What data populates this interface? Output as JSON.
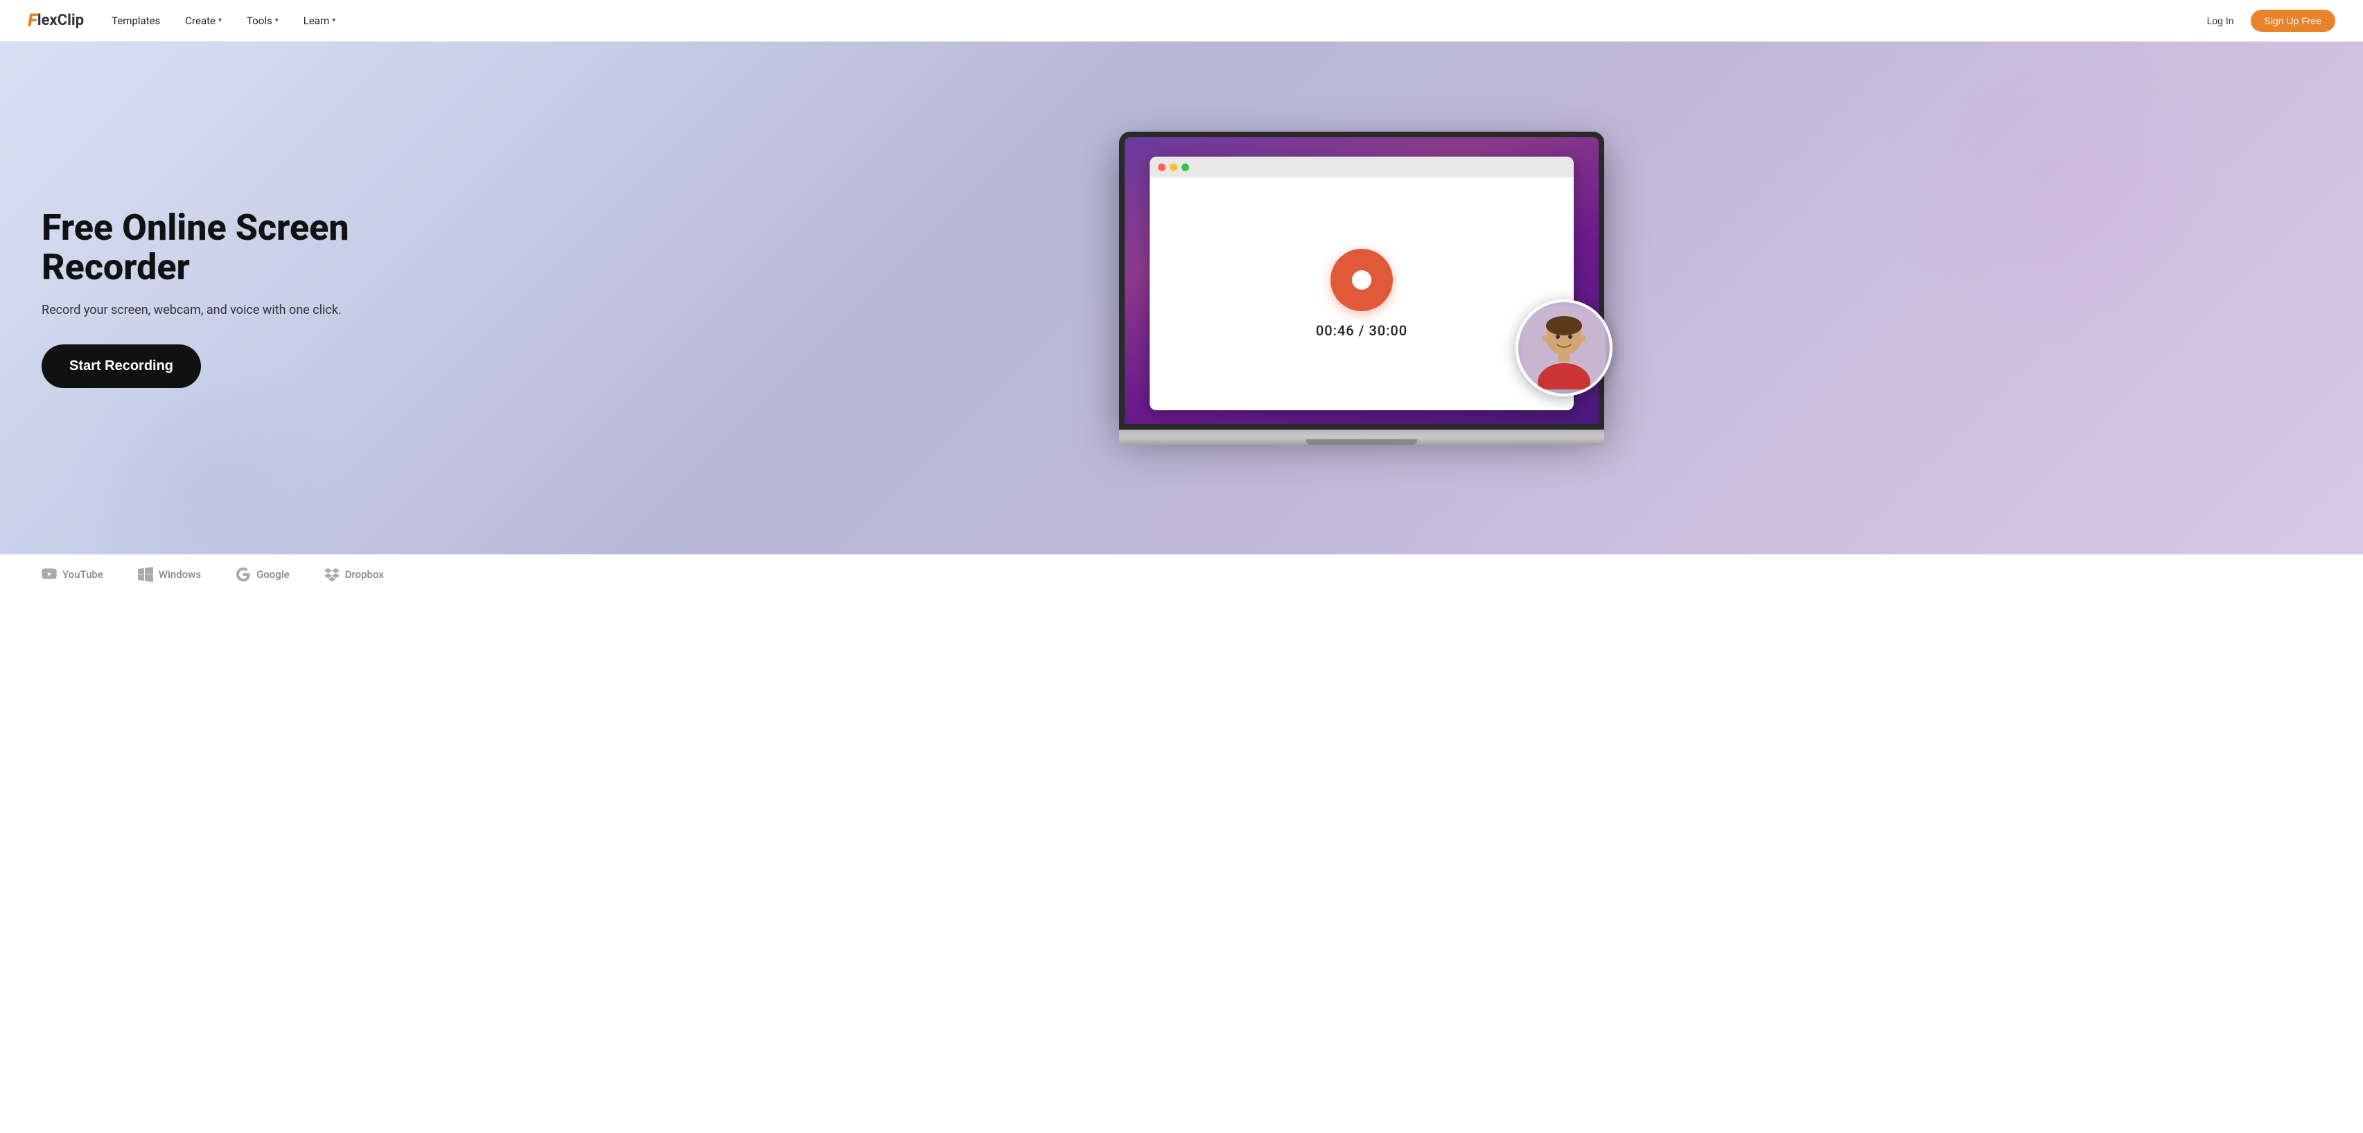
{
  "nav": {
    "logo_f": "F",
    "logo_text": "lexClip",
    "links": [
      {
        "id": "templates",
        "label": "Templates",
        "has_dropdown": false
      },
      {
        "id": "create",
        "label": "Create",
        "has_dropdown": true
      },
      {
        "id": "tools",
        "label": "Tools",
        "has_dropdown": true
      },
      {
        "id": "learn",
        "label": "Learn",
        "has_dropdown": true
      }
    ],
    "btn_login": "Log In",
    "btn_signup": "Sign Up Free"
  },
  "hero": {
    "title": "Free Online Screen Recorder",
    "subtitle": "Record your screen, webcam, and voice with one click.",
    "cta_label": "Start Recording",
    "timer": "00:46 / 30:00"
  },
  "brands": [
    {
      "id": "youtube",
      "label": "YouTube"
    },
    {
      "id": "windows",
      "label": "Windows"
    },
    {
      "id": "google",
      "label": "Google"
    },
    {
      "id": "dropbox",
      "label": "Dropbox"
    }
  ],
  "browser": {
    "dot_red": "#ff5f57",
    "dot_yellow": "#febc2e",
    "dot_green": "#28c840"
  }
}
